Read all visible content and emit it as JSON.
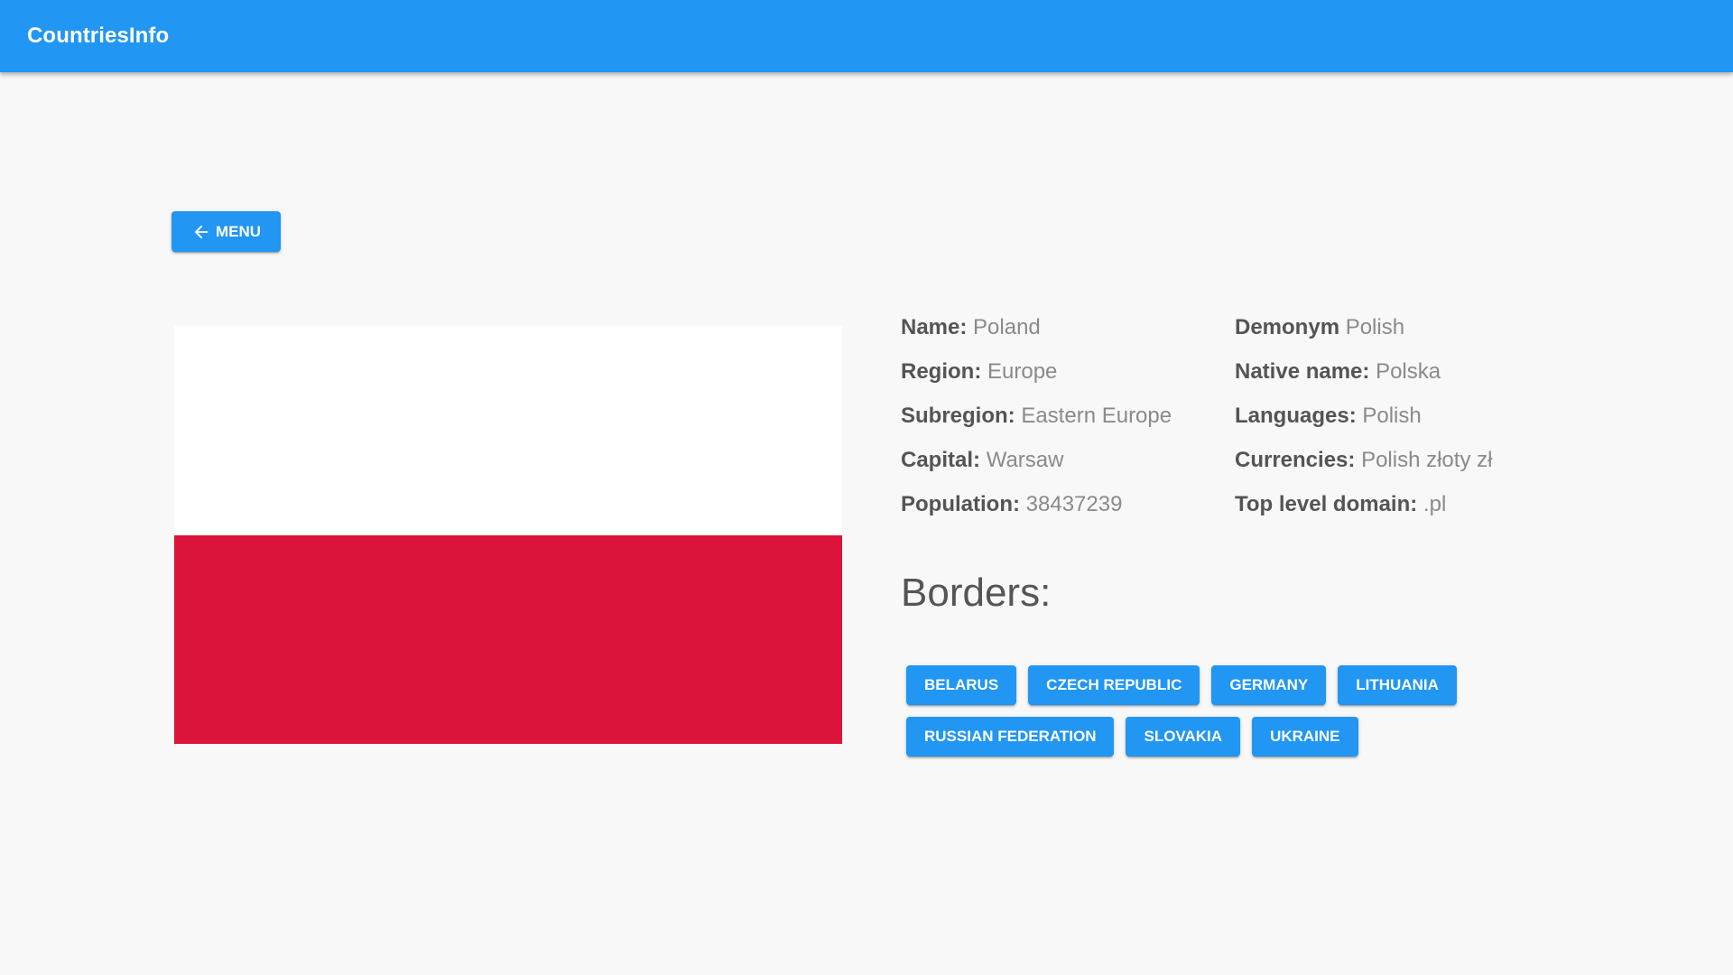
{
  "app": {
    "title": "CountriesInfo"
  },
  "nav": {
    "menu_label": "MENU"
  },
  "icons": {
    "back": "arrow-left-icon"
  },
  "colors": {
    "primary": "#2196f3",
    "flag_white": "#ffffff",
    "flag_red": "#dc143c",
    "background": "#f8f8f8"
  },
  "country": {
    "left": [
      {
        "label": "Name:",
        "value": "Poland"
      },
      {
        "label": "Region:",
        "value": "Europe"
      },
      {
        "label": "Subregion:",
        "value": "Eastern Europe"
      },
      {
        "label": "Capital:",
        "value": "Warsaw"
      },
      {
        "label": "Population:",
        "value": "38437239"
      }
    ],
    "right": [
      {
        "label": "Demonym",
        "value": "Polish"
      },
      {
        "label": "Native name:",
        "value": "Polska"
      },
      {
        "label": "Languages:",
        "value": "Polish"
      },
      {
        "label": "Currencies:",
        "value": "Polish złoty zł"
      },
      {
        "label": "Top level domain:",
        "value": ".pl"
      }
    ]
  },
  "borders": {
    "title": "Borders:",
    "items": [
      "BELARUS",
      "CZECH REPUBLIC",
      "GERMANY",
      "LITHUANIA",
      "RUSSIAN FEDERATION",
      "SLOVAKIA",
      "UKRAINE"
    ]
  }
}
